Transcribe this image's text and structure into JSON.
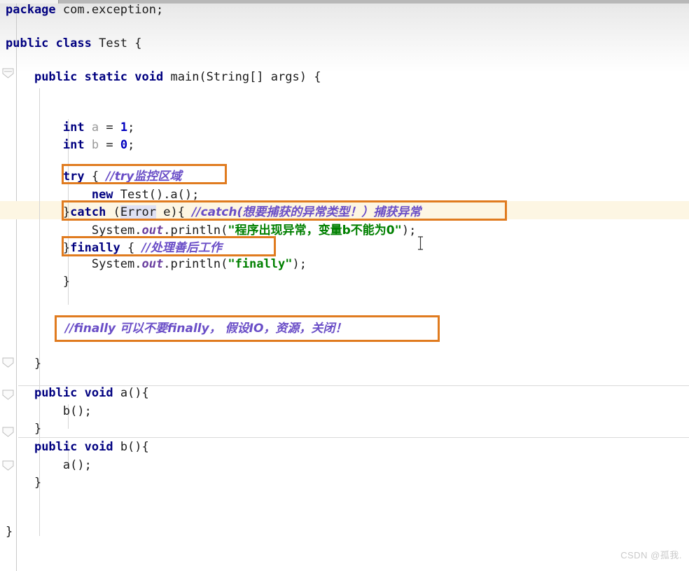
{
  "editor": {
    "language": "java",
    "file_class": "Test",
    "colors": {
      "keyword": "#000080",
      "string": "#008000",
      "comment": "#6a4ec7",
      "field": "#6a3fa0",
      "number": "#0000c0",
      "annotation_box": "#e07b1f",
      "current_line_highlight": "#fdf6e3",
      "identifier_highlight": "#dfe1f3",
      "unused_identifier": "#9a9a9a",
      "gutter_line": "#c9c9c9",
      "separator": "#d9d9d9",
      "watermark": "#c9c9c9"
    }
  },
  "code": {
    "line01": {
      "kw1": "package",
      "rest": " com.exception;"
    },
    "line03": {
      "kw1": "public",
      "kw2": "class",
      "name": " Test ",
      "brace": "{"
    },
    "line05": {
      "indent": "    ",
      "kw1": "public",
      "kw2": "static",
      "kw3": "void",
      "name": " main(String[] args) ",
      "brace": "{"
    },
    "line08": {
      "indent": "        ",
      "kw": "int",
      "var": " a ",
      "eq": "= ",
      "num": "1",
      "semi": ";"
    },
    "line09": {
      "indent": "        ",
      "kw": "int",
      "var": " b ",
      "eq": "= ",
      "num": "0",
      "semi": ";"
    },
    "line11": {
      "indent": "        ",
      "kw": "try",
      "open": " { ",
      "comment": "//try监控区域"
    },
    "line12": {
      "indent": "            ",
      "kw": "new",
      "rest": " Test().a();"
    },
    "line13": {
      "indent": "        ",
      "close": "}",
      "kw": "catch",
      "open": " (",
      "type": "Error",
      "tail": " e){ ",
      "comment": "//catch(想要捕获的异常类型！）捕获异常"
    },
    "line14": {
      "indent": "            ",
      "sys": "System.",
      "field": "out",
      "call": ".println(",
      "quote_open": "\"",
      "str": "程序出现异常，变量b不能为0",
      "quote_close": "\"",
      "tail": ");"
    },
    "line15": {
      "indent": "        ",
      "close": "}",
      "kw": "finally",
      "open": " { ",
      "comment": "//处理善后工作"
    },
    "line16": {
      "indent": "            ",
      "sys": "System.",
      "field": "out",
      "call": ".println(",
      "quote_open": "\"",
      "str": "finally",
      "quote_close": "\"",
      "tail": ");"
    },
    "line17": {
      "indent": "        ",
      "brace": "}"
    },
    "line19_comment": "//finally 可以不要finally， 假设IO，资源，关闭！",
    "line21": {
      "indent": "    ",
      "brace": "}"
    },
    "line23": {
      "indent": "    ",
      "kw1": "public",
      "kw2": "void",
      "name": " a(){"
    },
    "line24": {
      "indent": "        ",
      "rest": "b();"
    },
    "line25": {
      "indent": "    ",
      "brace": "}"
    },
    "line26": {
      "indent": "    ",
      "kw1": "public",
      "kw2": "void",
      "name": " b(){"
    },
    "line27": {
      "indent": "        ",
      "rest": "a();"
    },
    "line28": {
      "indent": "    ",
      "brace": "}"
    },
    "line31": {
      "brace": "}"
    }
  },
  "annotations": {
    "box_try_label": "try-line-annotation-box",
    "box_catch_label": "catch-line-annotation-box",
    "box_finally_label": "finally-line-annotation-box",
    "box_note_label": "finally-note-annotation-box"
  },
  "watermark": {
    "text": "CSDN @孤我."
  }
}
